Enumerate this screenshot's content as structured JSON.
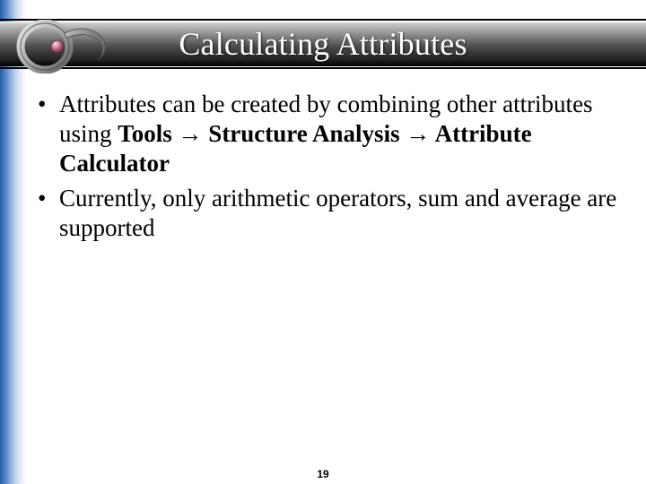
{
  "slide": {
    "title": "Calculating Attributes",
    "bullets": [
      {
        "pre": "Attributes can be created by combining other attributes using ",
        "bold": "Tools → Structure Analysis → Attribute Calculator",
        "post": ""
      },
      {
        "pre": "Currently, only arithmetic operators, sum and average are supported",
        "bold": "",
        "post": ""
      }
    ],
    "page_number": "19"
  }
}
